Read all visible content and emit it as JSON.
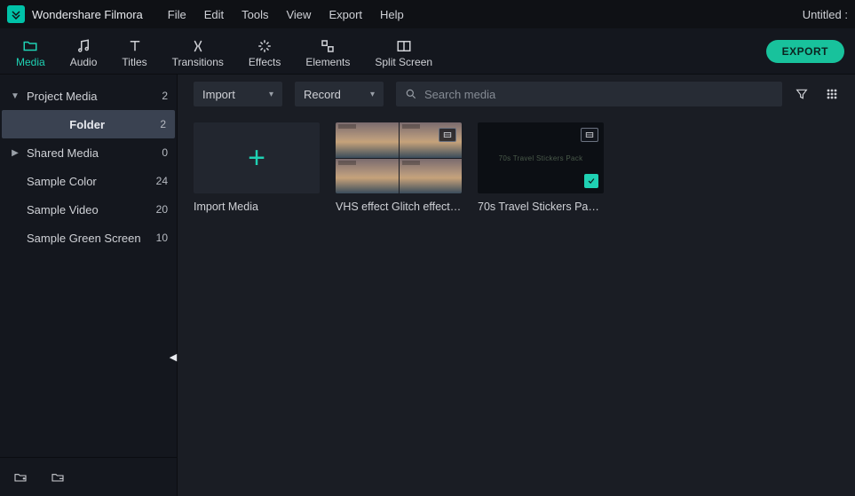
{
  "app": {
    "title": "Wondershare Filmora",
    "document_title": "Untitled :"
  },
  "menu": {
    "items": [
      "File",
      "Edit",
      "Tools",
      "View",
      "Export",
      "Help"
    ]
  },
  "toolbar": {
    "export_label": "EXPORT",
    "tabs": [
      {
        "label": "Media",
        "icon": "folder",
        "active": true
      },
      {
        "label": "Audio",
        "icon": "music",
        "active": false
      },
      {
        "label": "Titles",
        "icon": "text",
        "active": false
      },
      {
        "label": "Transitions",
        "icon": "transition",
        "active": false
      },
      {
        "label": "Effects",
        "icon": "sparkle",
        "active": false
      },
      {
        "label": "Elements",
        "icon": "elements",
        "active": false
      },
      {
        "label": "Split Screen",
        "icon": "split",
        "active": false
      }
    ]
  },
  "sidebar": {
    "items": [
      {
        "label": "Project Media",
        "count": 2,
        "depth": 0,
        "expandable": true,
        "expanded": true,
        "selected": false
      },
      {
        "label": "Folder",
        "count": 2,
        "depth": 1,
        "expandable": false,
        "expanded": false,
        "selected": true
      },
      {
        "label": "Shared Media",
        "count": 0,
        "depth": 0,
        "expandable": true,
        "expanded": false,
        "selected": false
      },
      {
        "label": "Sample Color",
        "count": 24,
        "depth": 0,
        "expandable": false,
        "expanded": false,
        "selected": false
      },
      {
        "label": "Sample Video",
        "count": 20,
        "depth": 0,
        "expandable": false,
        "expanded": false,
        "selected": false
      },
      {
        "label": "Sample Green Screen",
        "count": 10,
        "depth": 0,
        "expandable": false,
        "expanded": false,
        "selected": false
      }
    ]
  },
  "controls": {
    "import_label": "Import",
    "record_label": "Record",
    "search_placeholder": "Search media"
  },
  "media": {
    "items": [
      {
        "kind": "import",
        "label": "Import Media"
      },
      {
        "kind": "preview",
        "label": "VHS effect Glitch effect…",
        "badge": "film"
      },
      {
        "kind": "dark",
        "label": "70s Travel Stickers Pack…",
        "badge": "film",
        "checked": true,
        "thumb_text": "70s Travel Stickers Pack"
      }
    ]
  }
}
